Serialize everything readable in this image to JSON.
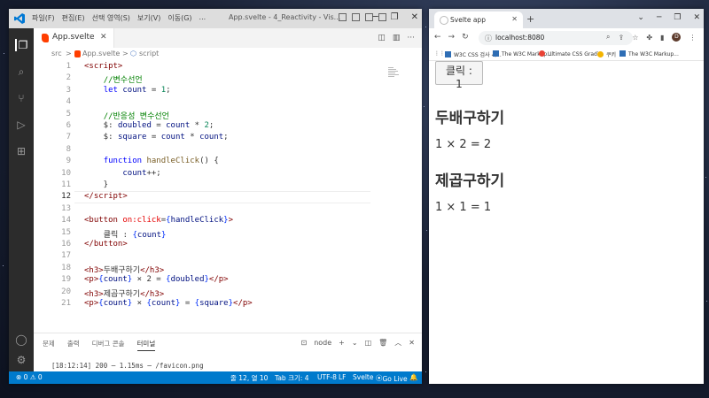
{
  "vscode": {
    "menu": [
      "파일(F)",
      "편집(E)",
      "선택 영역(S)",
      "보기(V)",
      "이동(G)",
      "..."
    ],
    "title": "App.svelte - 4_Reactivity - Vis...",
    "tab_label": "App.svelte",
    "breadcrumb": [
      "src",
      ">",
      "App.svelte",
      ">",
      "script"
    ],
    "code_lines": [
      {
        "n": "1",
        "html": "<span class='t-tag'>&lt;script&gt;</span>"
      },
      {
        "n": "2",
        "html": "    <span class='t-comment'>//변수선언</span>"
      },
      {
        "n": "3",
        "html": "    <span class='t-kw'>let</span> <span class='t-var'>count</span> = <span class='t-num'>1</span>;"
      },
      {
        "n": "4",
        "html": ""
      },
      {
        "n": "5",
        "html": "    <span class='t-comment'>//반응성 변수선언</span>"
      },
      {
        "n": "6",
        "html": "    $: <span class='t-var'>doubled</span> = <span class='t-var'>count</span> * <span class='t-num'>2</span>;"
      },
      {
        "n": "7",
        "html": "    $: <span class='t-var'>square</span> = <span class='t-var'>count</span> * <span class='t-var'>count</span>;"
      },
      {
        "n": "8",
        "html": ""
      },
      {
        "n": "9",
        "html": "    <span class='t-kw'>function</span> <span class='t-fn'>handleClick</span>() {"
      },
      {
        "n": "10",
        "html": "        <span class='t-var'>count</span>++;"
      },
      {
        "n": "11",
        "html": "    }"
      },
      {
        "n": "12",
        "html": "<span class='t-tag'>&lt;/script&gt;</span>"
      },
      {
        "n": "13",
        "html": ""
      },
      {
        "n": "14",
        "html": "<span class='t-tag'>&lt;button</span> <span class='t-attr'>on:click</span>=<span class='t-brace'>{</span><span class='t-var'>handleClick</span><span class='t-brace'>}</span><span class='t-tag'>&gt;</span>"
      },
      {
        "n": "15",
        "html": "    클릭 : <span class='t-brace'>{</span><span class='t-var'>count</span><span class='t-brace'>}</span>"
      },
      {
        "n": "16",
        "html": "<span class='t-tag'>&lt;/button&gt;</span>"
      },
      {
        "n": "17",
        "html": ""
      },
      {
        "n": "18",
        "html": "<span class='t-tag'>&lt;h3&gt;</span>두배구하기<span class='t-tag'>&lt;/h3&gt;</span>"
      },
      {
        "n": "19",
        "html": "<span class='t-tag'>&lt;p&gt;</span><span class='t-brace'>{</span><span class='t-var'>count</span><span class='t-brace'>}</span> × 2 = <span class='t-brace'>{</span><span class='t-var'>doubled</span><span class='t-brace'>}</span><span class='t-tag'>&lt;/p&gt;</span>"
      },
      {
        "n": "20",
        "html": "<span class='t-tag'>&lt;h3&gt;</span>제곱구하기<span class='t-tag'>&lt;/h3&gt;</span>"
      },
      {
        "n": "21",
        "html": "<span class='t-tag'>&lt;p&gt;</span><span class='t-brace'>{</span><span class='t-var'>count</span><span class='t-brace'>}</span> × <span class='t-brace'>{</span><span class='t-var'>count</span><span class='t-brace'>}</span> = <span class='t-brace'>{</span><span class='t-var'>square</span><span class='t-brace'>}</span><span class='t-tag'>&lt;/p&gt;</span>"
      }
    ],
    "active_line": "12",
    "panel_tabs": [
      "문제",
      "출력",
      "디버그 콘솔",
      "터미널"
    ],
    "panel_active": "터미널",
    "terminal_shell": "node",
    "terminal_line": "[18:12:14] 200 ─ 1.15ms ─ /favicon.png",
    "status": {
      "problems": "⊗ 0 ⚠ 0",
      "position": "줄 12, 열 10",
      "tab": "Tab 크기: 4",
      "encoding": "UTF-8",
      "eol": "LF",
      "language": "Svelte",
      "golive": "Go Live"
    },
    "colors": {
      "statusbar": "#007acc",
      "activitybar": "#2c2c2c",
      "svelte": "#ff3e00"
    }
  },
  "browser": {
    "tab_title": "Svelte app",
    "url": "localhost:8080",
    "bookmarks": [
      "W3C CSS 검사 서...",
      "The W3C Markup...",
      "Ultimate CSS Gradi...",
      "쿠키",
      "The W3C Markup..."
    ],
    "avatar_letter": "D",
    "page": {
      "button_label": "클릭 : 1",
      "h3_double": "두배구하기",
      "p_double": "1 × 2 = 2",
      "h3_square": "제곱구하기",
      "p_square": "1 × 1 = 1"
    }
  }
}
